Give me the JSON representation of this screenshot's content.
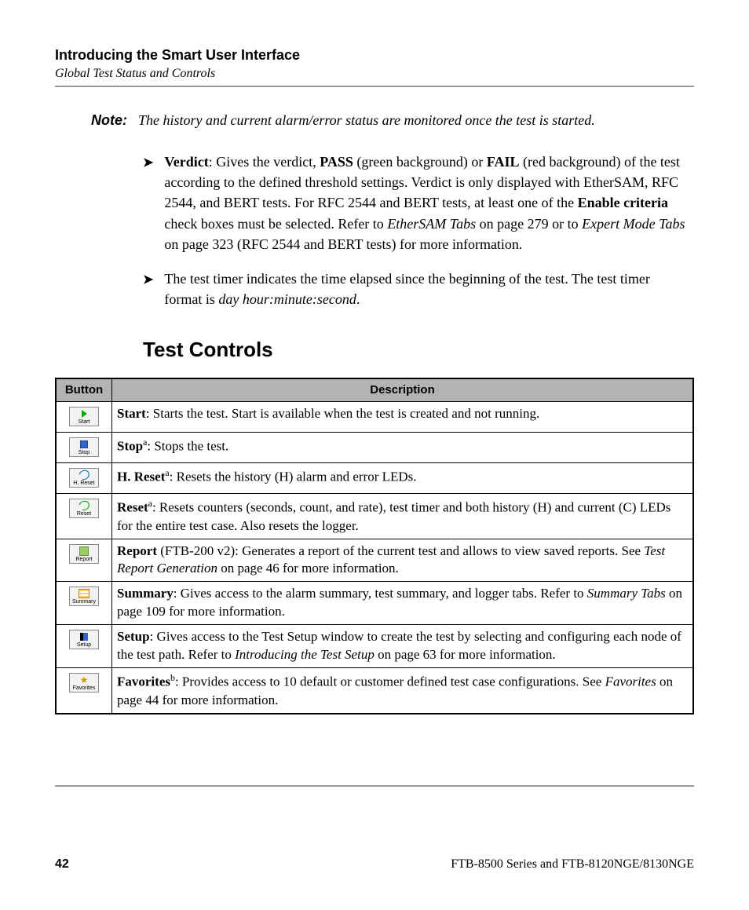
{
  "header": {
    "title": "Introducing the Smart User Interface",
    "subtitle": "Global Test Status and Controls"
  },
  "note": {
    "label": "Note:",
    "text": "The history and current alarm/error status are monitored once the test is started."
  },
  "bullets": [
    {
      "lead": "Verdict",
      "t1": ": Gives the verdict, ",
      "b1": "PASS",
      "t2": " (green background) or ",
      "b2": "FAIL",
      "t3": " (red background) of the test according to the defined threshold settings. Verdict is only displayed with EtherSAM, RFC 2544, and BERT tests. For RFC 2544 and BERT tests, at least one of the ",
      "b3": "Enable criteria",
      "t4": " check boxes must be selected. Refer to ",
      "i1": "EtherSAM Tabs",
      "t5": " on page 279 or to ",
      "i2": "Expert Mode Tabs",
      "t6": " on page 323 (RFC 2544 and BERT tests) for more information."
    },
    {
      "t1": "The test timer indicates the time elapsed since the beginning of the test. The test timer format is ",
      "i1": "day hour:minute:second",
      "t2": "."
    }
  ],
  "section_heading": "Test Controls",
  "table": {
    "headers": {
      "button": "Button",
      "description": "Description"
    },
    "rows": [
      {
        "btn_label": "Start",
        "icon": "play",
        "lead": "Start",
        "sup": "",
        "rest": ": Starts the test. Start is available when the test is created and not running."
      },
      {
        "btn_label": "Stop",
        "icon": "stop",
        "lead": "Stop",
        "sup": "a",
        "rest": ": Stops the test."
      },
      {
        "btn_label": "H. Reset",
        "icon": "hreset",
        "lead": "H. Reset",
        "sup": "a",
        "rest": ": Resets the history (H) alarm and error LEDs."
      },
      {
        "btn_label": "Reset",
        "icon": "reset",
        "lead": "Reset",
        "sup": "a",
        "rest": ": Resets counters (seconds, count, and rate), test timer and both history (H) and current (C) LEDs for the entire test case. Also resets the logger."
      },
      {
        "btn_label": "Report",
        "icon": "report",
        "lead": "Report",
        "sup": "",
        "rest_pre": " (FTB-200 v2): Generates a report of the current test and allows to view saved reports. See ",
        "rest_ital": "Test Report Generation",
        "rest_post": " on page 46 for more information."
      },
      {
        "btn_label": "Summary",
        "icon": "summary",
        "lead": "Summary",
        "sup": "",
        "rest_pre": ": Gives access to the alarm summary, test summary, and logger tabs. Refer to ",
        "rest_ital": "Summary Tabs",
        "rest_post": " on page 109 for more information."
      },
      {
        "btn_label": "Setup",
        "icon": "setup",
        "lead": "Setup",
        "sup": "",
        "rest_pre": ": Gives access to the Test Setup window to create the test by selecting and configuring each node of the test path. Refer to ",
        "rest_ital": "Introducing the Test Setup",
        "rest_post": " on page 63 for more information."
      },
      {
        "btn_label": "Favorites",
        "icon": "fav",
        "lead": "Favorites",
        "sup": "b",
        "rest_pre": ": Provides access to 10 default or customer defined test case configurations. See ",
        "rest_ital": "Favorites",
        "rest_post": " on page 44 for more information."
      }
    ]
  },
  "footer": {
    "page": "42",
    "product": "FTB-8500 Series and FTB-8120NGE/8130NGE"
  }
}
